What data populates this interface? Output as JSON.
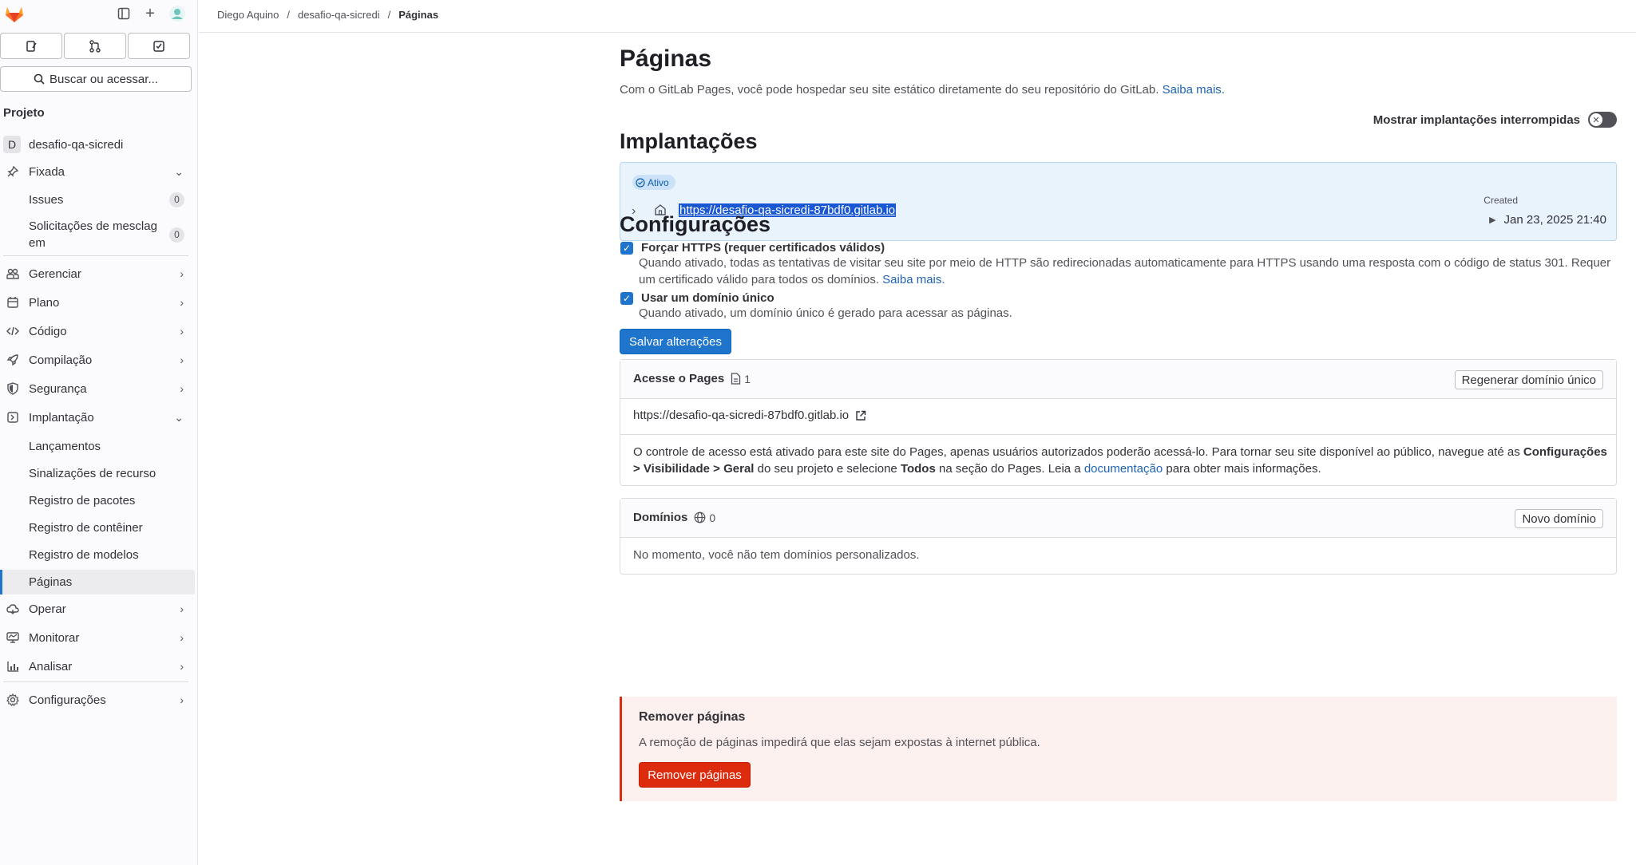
{
  "breadcrumbs": {
    "owner": "Diego Aquino",
    "project": "desafio-qa-sicredi",
    "current": "Páginas"
  },
  "sidebar": {
    "search_label": "Buscar ou acessar...",
    "section_title": "Projeto",
    "project_initial": "D",
    "project_name": "desafio-qa-sicredi",
    "pinned_label": "Fixada",
    "pinned_items": [
      {
        "label": "Issues",
        "count": "0"
      },
      {
        "label": "Solicitações de mesclag",
        "label2": "em",
        "count": "0"
      }
    ],
    "items": [
      {
        "label": "Gerenciar",
        "icon": "users-icon"
      },
      {
        "label": "Plano",
        "icon": "calendar-icon"
      },
      {
        "label": "Código",
        "icon": "code-icon"
      },
      {
        "label": "Compilação",
        "icon": "rocket-icon"
      },
      {
        "label": "Segurança",
        "icon": "shield-icon"
      },
      {
        "label": "Implantação",
        "icon": "deploy-icon"
      }
    ],
    "deploy_sub": [
      "Lançamentos",
      "Sinalizações de recurso",
      "Registro de pacotes",
      "Registro de contêiner",
      "Registro de modelos",
      "Páginas"
    ],
    "items_after": [
      {
        "label": "Operar",
        "icon": "cloud-icon"
      },
      {
        "label": "Monitorar",
        "icon": "monitor-icon"
      },
      {
        "label": "Analisar",
        "icon": "chart-icon"
      }
    ],
    "settings_label": "Configurações"
  },
  "page": {
    "title": "Páginas",
    "intro": "Com o GitLab Pages, você pode hospedar seu site estático diretamente do seu repositório do GitLab.",
    "intro_link": "Saiba mais.",
    "toggle_label": "Mostrar implantações interrompidas"
  },
  "deployments": {
    "title": "Implantações",
    "status": "Ativo",
    "url": "https://desafio-qa-sicredi-87bdf0.gitlab.io",
    "created_label": "Created",
    "created_value": "Jan 23, 2025 21:40"
  },
  "settings": {
    "title": "Configurações",
    "force_https_label": "Forçar HTTPS (requer certificados válidos)",
    "force_https_help": "Quando ativado, todas as tentativas de visitar seu site por meio de HTTP são redirecionadas automaticamente para HTTPS usando uma resposta com o código de status 301. Requer um certificado válido para todos os domínios.",
    "force_https_link": "Saiba mais.",
    "unique_domain_label": "Usar um domínio único",
    "unique_domain_help": "Quando ativado, um domínio único é gerado para acessar as páginas.",
    "save_label": "Salvar alterações"
  },
  "access": {
    "title": "Acesse o Pages",
    "count": "1",
    "regen_label": "Regenerar domínio único",
    "url": "https://desafio-qa-sicredi-87bdf0.gitlab.io",
    "notice_1": "O controle de acesso está ativado para este site do Pages, apenas usuários autorizados poderão acessá-lo. Para tornar seu site disponível ao público, navegue até as ",
    "notice_bold_1": "Configurações > Visibilidade > Geral",
    "notice_2": " do seu projeto e selecione ",
    "notice_bold_2": "Todos",
    "notice_3": " na seção do Pages. Leia a ",
    "notice_link": "documentação",
    "notice_4": " para obter mais informações."
  },
  "domains": {
    "title": "Domínios",
    "count": "0",
    "new_label": "Novo domínio",
    "empty": "No momento, você não tem domínios personalizados."
  },
  "danger": {
    "title": "Remover páginas",
    "text": "A remoção de páginas impedirá que elas sejam expostas à internet pública.",
    "button": "Remover páginas"
  },
  "colors": {
    "primary": "#1f75cb",
    "danger": "#dd2b0e",
    "link": "#1f63b5"
  }
}
